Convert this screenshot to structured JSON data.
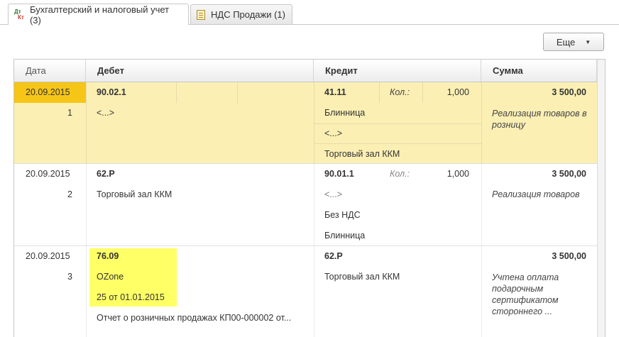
{
  "tabs": [
    {
      "label": "Бухгалтерский и налоговый учет (3)",
      "icon": "dt-kt-icon"
    },
    {
      "label": "НДС Продажи (1)",
      "icon": "document-icon"
    }
  ],
  "toolbar": {
    "more_label": "Еще",
    "more_arrow": "▼"
  },
  "columns": {
    "date": "Дата",
    "debit": "Дебет",
    "credit": "Кредит",
    "sum": "Сумма"
  },
  "entries": [
    {
      "date": "20.09.2015",
      "num": "1",
      "debit_account": "90.02.1",
      "debit_sub1": "<...>",
      "credit_account": "41.11",
      "qty_label": "Кол.:",
      "qty": "1,000",
      "credit_sub1": "Блинница",
      "credit_sub2": "<...>",
      "credit_sub3": "Торговый зал ККМ",
      "amount": "3 500,00",
      "description": "Реализация товаров в розницу"
    },
    {
      "date": "20.09.2015",
      "num": "2",
      "debit_account": "62.Р",
      "debit_sub1": "Торговый зал ККМ",
      "credit_account": "90.01.1",
      "qty_label": "Кол.:",
      "qty": "1,000",
      "credit_sub1": "<...>",
      "credit_sub2": "Без НДС",
      "credit_sub3": "Блинница",
      "amount": "3 500,00",
      "description": "Реализация товаров"
    },
    {
      "date": "20.09.2015",
      "num": "3",
      "debit_account": "76.09",
      "debit_sub1": "OZone",
      "debit_sub2": "25 от 01.01.2015",
      "debit_sub3": "Отчет о розничных продажах КП00-000002 от...",
      "credit_account": "62.Р",
      "credit_sub1": "Торговый зал ККМ",
      "amount": "3 500,00",
      "description_lines": [
        "Учтена оплата",
        "подарочным",
        "сертификатом",
        "стороннего ..."
      ]
    }
  ],
  "colors": {
    "selected_row": "#fbefb4",
    "selected_date": "#f5c518",
    "highlight": "#ffff66"
  }
}
